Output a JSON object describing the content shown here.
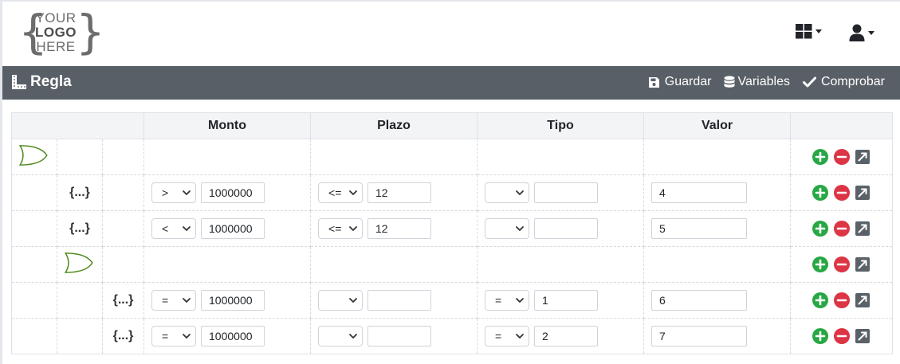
{
  "logo": {
    "line1": "YOUR",
    "line2": "LOGO",
    "line3": "HERE",
    "brace_left": "{",
    "brace_right": "}"
  },
  "header": {
    "grid_icon": "grid-icon",
    "user_icon": "user-icon"
  },
  "toolbar": {
    "title": "Regla",
    "title_icon": "ruler-icon",
    "save_label": "Guardar",
    "variables_label": "Variables",
    "check_label": "Comprobar"
  },
  "table": {
    "columns": [
      "Monto",
      "Plazo",
      "Tipo",
      "Valor"
    ],
    "condition_label": "{...}",
    "rows": [
      {
        "kind": "gate",
        "level": 0
      },
      {
        "kind": "cond",
        "level": 1,
        "monto": {
          "op": ">",
          "val": "1000000"
        },
        "plazo": {
          "op": "<=",
          "val": "12"
        },
        "tipo": {
          "op": "",
          "val": ""
        },
        "valor": "4"
      },
      {
        "kind": "cond",
        "level": 1,
        "monto": {
          "op": "<",
          "val": "1000000"
        },
        "plazo": {
          "op": "<=",
          "val": "12"
        },
        "tipo": {
          "op": "",
          "val": ""
        },
        "valor": "5"
      },
      {
        "kind": "gate",
        "level": 1
      },
      {
        "kind": "cond",
        "level": 2,
        "monto": {
          "op": "=",
          "val": "1000000"
        },
        "plazo": {
          "op": "",
          "val": ""
        },
        "tipo": {
          "op": "=",
          "val": "1"
        },
        "valor": "6"
      },
      {
        "kind": "cond",
        "level": 2,
        "monto": {
          "op": "=",
          "val": "1000000"
        },
        "plazo": {
          "op": "",
          "val": ""
        },
        "tipo": {
          "op": "=",
          "val": "2"
        },
        "valor": "7"
      }
    ]
  },
  "colors": {
    "toolbar_bg": "#595f66",
    "add": "#28a745",
    "remove": "#dc3545",
    "edit": "#5a6268",
    "gate_stroke": "#4e8a1e",
    "gate_fill": "#ffffff"
  }
}
